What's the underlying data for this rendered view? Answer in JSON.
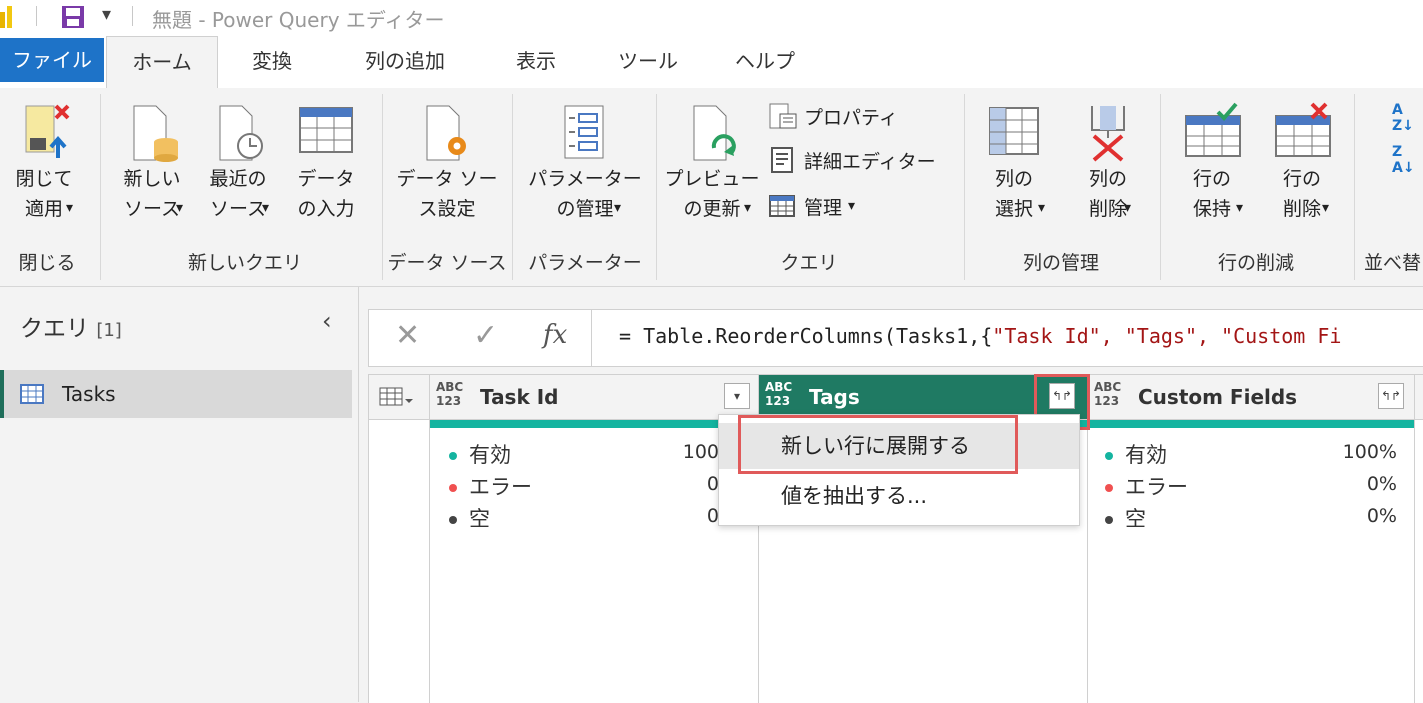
{
  "window": {
    "title": "無題 - Power Query エディター"
  },
  "tabs": [
    "ファイル",
    "ホーム",
    "変換",
    "列の追加",
    "表示",
    "ツール",
    "ヘルプ"
  ],
  "ribbon": {
    "close_apply": "閉じて\n適用",
    "new_source": "新しい\nソース",
    "recent_sources": "最近の\nソース",
    "enter_data": "データ\nの入力",
    "data_source_settings": "データ ソー\nス設定",
    "manage_parameters": "パラメーター\nの管理",
    "refresh_preview": "プレビュー\nの更新",
    "properties": "プロパティ",
    "advanced_editor": "詳細エディター",
    "manage": "管理",
    "choose_columns": "列の\n選択",
    "remove_columns": "列の\n削除",
    "keep_rows": "行の\n保持",
    "remove_rows": "行の\n削除",
    "groups": {
      "close": "閉じる",
      "new_query": "新しいクエリ",
      "data_source": "データ ソース",
      "parameters": "パラメーター",
      "query": "クエリ",
      "manage_columns": "列の管理",
      "reduce_rows": "行の削減",
      "sort": "並べ替"
    }
  },
  "queries": {
    "header": "クエリ",
    "count": "[1]",
    "items": [
      {
        "name": "Tasks"
      }
    ]
  },
  "formula": {
    "fx": "fx",
    "text_prefix": "= Table.ReorderColumns(Tasks1,{",
    "text_strings": "\"Task Id\", \"Tags\", \"Custom Fi"
  },
  "columns": [
    {
      "type": "ABC\n123",
      "name": "Task Id",
      "valid_label": "有効",
      "valid": "100",
      "error_label": "エラー",
      "error": "0",
      "empty_label": "空",
      "empty": "0"
    },
    {
      "type": "ABC\n123",
      "name": "Tags"
    },
    {
      "type": "ABC\n123",
      "name": "Custom Fields",
      "valid_label": "有効",
      "valid": "100%",
      "error_label": "エラー",
      "error": "0%",
      "empty_label": "空",
      "empty": "0%"
    }
  ],
  "dropdown": {
    "expand": "新しい行に展開する",
    "extract": "値を抽出する..."
  },
  "colors": {
    "file_tab": "#1e73c8",
    "selected_column": "#1f7a63",
    "valid_dot": "#14b4a0",
    "error_dot": "#f05050",
    "empty_dot": "#444444",
    "highlight": "#e05a5a"
  }
}
